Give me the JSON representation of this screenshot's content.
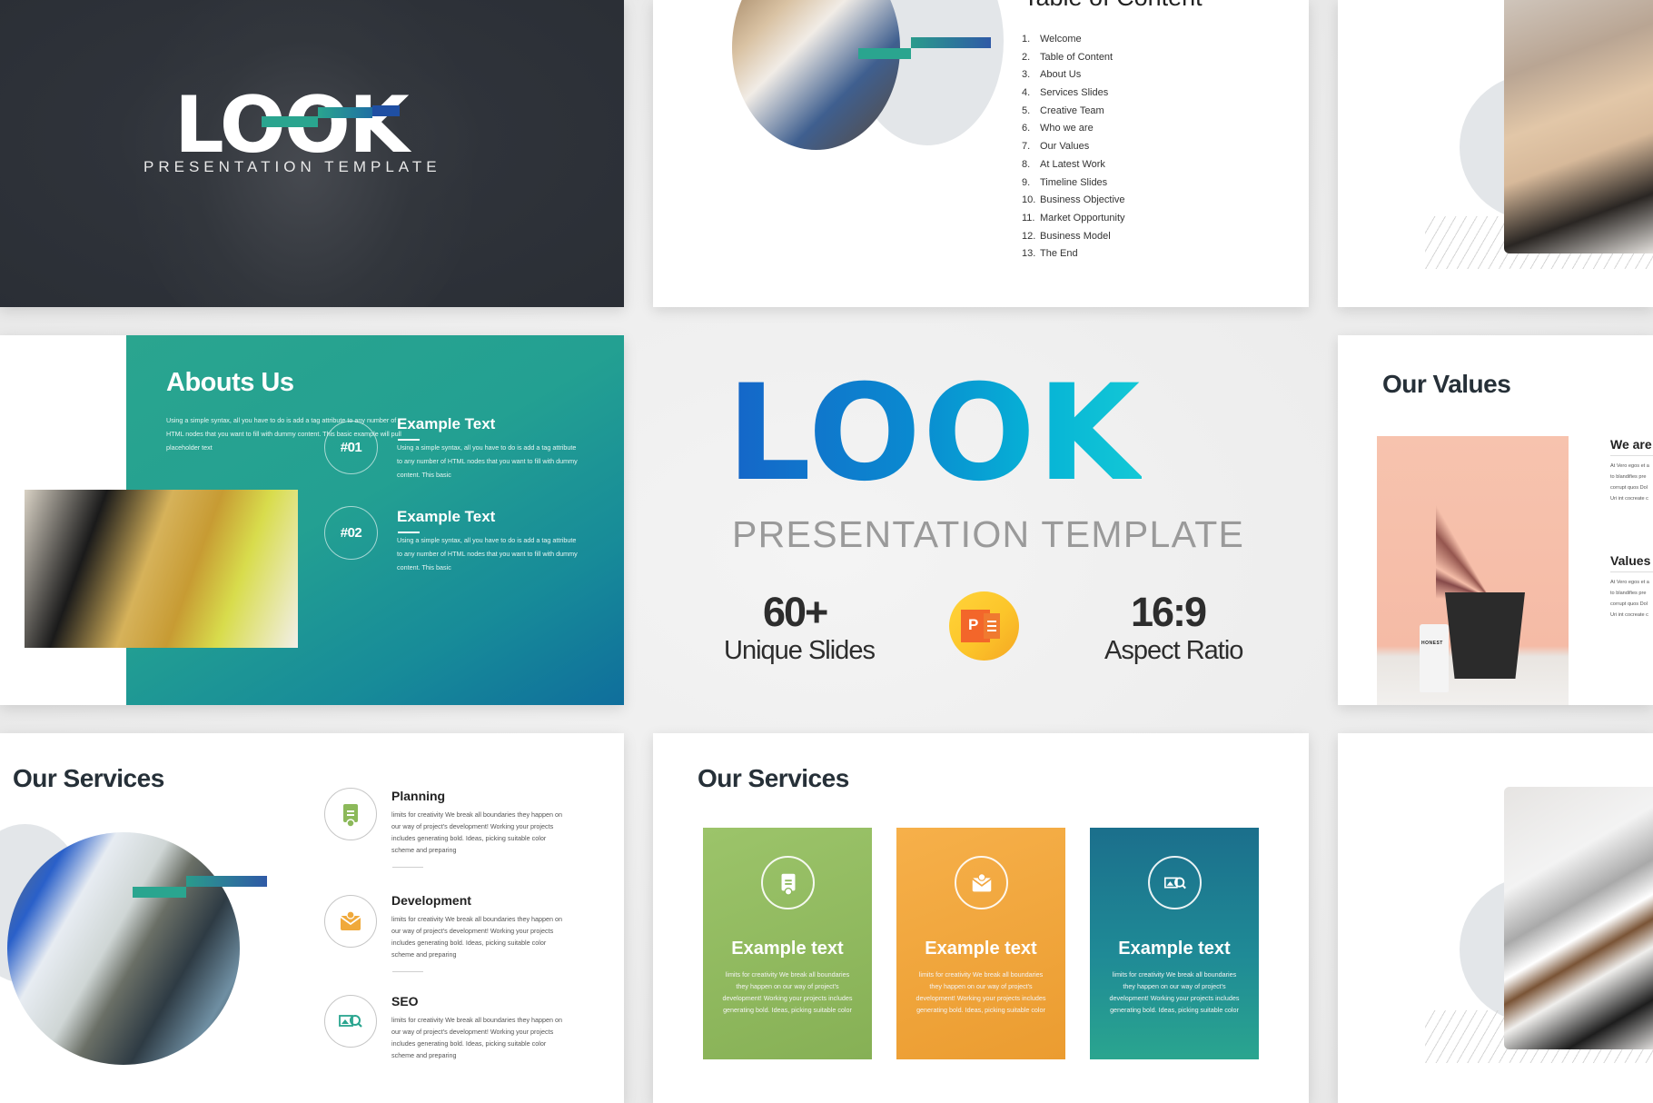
{
  "cover": {
    "logo": "LOOK",
    "subtitle": "PRESENTATION TEMPLATE"
  },
  "toc": {
    "title": "Table of Content",
    "items": [
      {
        "num": "1.",
        "label": "Welcome"
      },
      {
        "num": "2.",
        "label": "Table of Content"
      },
      {
        "num": "3.",
        "label": "About Us"
      },
      {
        "num": "4.",
        "label": "Services Slides"
      },
      {
        "num": "5.",
        "label": "Creative Team"
      },
      {
        "num": "6.",
        "label": "Who we are"
      },
      {
        "num": "7.",
        "label": "Our Values"
      },
      {
        "num": "8.",
        "label": "At Latest Work"
      },
      {
        "num": "9.",
        "label": "Timeline Slides"
      },
      {
        "num": "10.",
        "label": "Business Objective"
      },
      {
        "num": "11.",
        "label": "Market Opportunity"
      },
      {
        "num": "12.",
        "label": "Business Model"
      },
      {
        "num": "13.",
        "label": "The End"
      }
    ]
  },
  "about": {
    "title": "Abouts Us",
    "description": "Using a simple syntax, all you have to do is add a tag attribute to any number of HTML nodes that you want to fill with dummy content. This basic example will pull placeholder text",
    "items": [
      {
        "number": "#01",
        "title": "Example Text",
        "text": "Using a simple syntax, all you have to do is add a tag attribute to any number of HTML nodes that you want to fill with dummy content. This basic"
      },
      {
        "number": "#02",
        "title": "Example Text",
        "text": "Using a simple syntax, all you have to do is add a tag attribute to any number of HTML nodes that you want to fill with dummy content. This basic"
      }
    ]
  },
  "hero": {
    "logo": "LOOK",
    "subtitle": "PRESENTATION TEMPLATE",
    "stats": [
      {
        "value": "60+",
        "label": "Unique Slides"
      },
      {
        "value": "16:9",
        "label": "Aspect Ratio"
      }
    ],
    "app_icon": "powerpoint-icon",
    "app_icon_letter": "P",
    "gradient_colors": [
      "#1565c8",
      "#0a8ad0",
      "#13c8d6"
    ]
  },
  "values": {
    "title": "Our Values",
    "product_label": "HONEST",
    "blocks": [
      {
        "heading": "We are",
        "lines": [
          "At Vero egos et a",
          "to blandifies pre",
          "corrupt quos Dol",
          "Uri int cocreate c"
        ]
      },
      {
        "heading": "Values",
        "lines": [
          "At Vero egos et a",
          "to blandifies pre",
          "corrupt quos Dol",
          "Uri int cocreate c"
        ]
      }
    ]
  },
  "services_list": {
    "title": "Our Services",
    "items": [
      {
        "title": "Planning",
        "icon": "planner-icon",
        "color": "#8cb95a",
        "text": "limits for creativity We break all boundaries they happen on our way of project's development! Working your projects includes generating bold. Ideas, picking suitable color scheme and preparing"
      },
      {
        "title": "Development",
        "icon": "envelope-icon",
        "color": "#f0a93b",
        "text": "limits for creativity We break all boundaries they happen on our way of project's development! Working your projects includes generating bold. Ideas, picking suitable color scheme and preparing"
      },
      {
        "title": "SEO",
        "icon": "image-search-icon",
        "color": "#2aa58f",
        "text": "limits for creativity We break all boundaries they happen on our way of project's development! Working your projects includes generating bold. Ideas, picking suitable color scheme and preparing"
      }
    ]
  },
  "services_cards": {
    "title": "Our Services",
    "cards": [
      {
        "title": "Example text",
        "icon": "planner-icon",
        "color": "#8fba5c",
        "text": "limits for creativity We break all boundaries they happen on our way of project's development! Working your projects includes generating bold. Ideas, picking suitable color"
      },
      {
        "title": "Example text",
        "icon": "envelope-icon",
        "color": "#f2a63e",
        "text": "limits for creativity We break all boundaries they happen on our way of project's development! Working your projects includes generating bold. Ideas, picking suitable color"
      },
      {
        "title": "Example text",
        "icon": "image-search-icon",
        "color": "#1f8f96",
        "text": "limits for creativity We break all boundaries they happen on our way of project's development! Working your projects includes generating bold. Ideas, picking suitable color"
      }
    ]
  }
}
